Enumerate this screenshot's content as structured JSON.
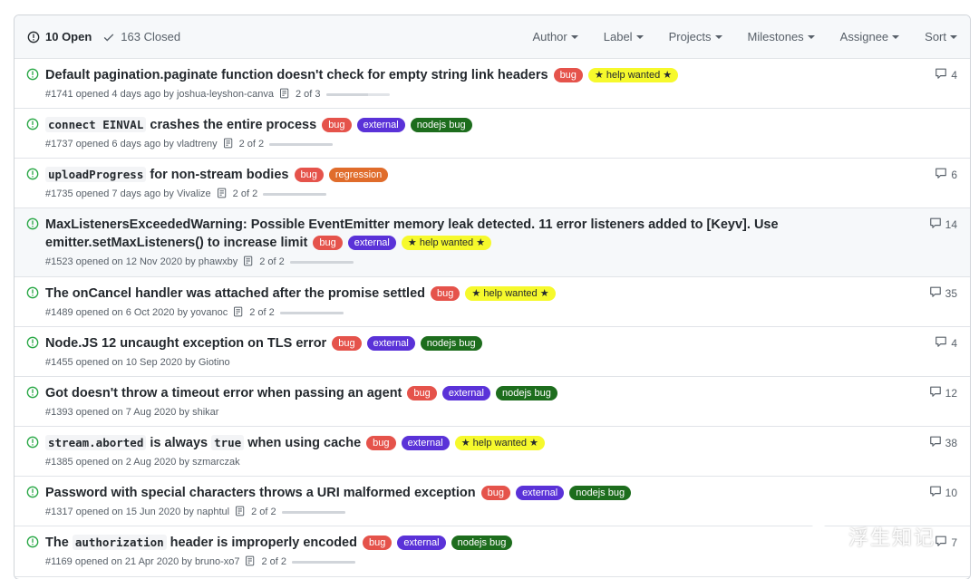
{
  "header": {
    "open_label": "10 Open",
    "closed_label": "163 Closed",
    "filters": [
      "Author",
      "Label",
      "Projects",
      "Milestones",
      "Assignee",
      "Sort"
    ]
  },
  "label_colors": {
    "bug": "#e5534b",
    "external": "#5a32d8",
    "nodejs bug": "#1d6d1d",
    "★ help wanted ★": "#f6f92c",
    "regression": "#e06c2b"
  },
  "issues": [
    {
      "title": "Default pagination.paginate function doesn't check for empty string link headers",
      "labels": [
        "bug",
        "★ help wanted ★"
      ],
      "meta": "#1741 opened 4 days ago by joshua-leyshon-canva",
      "tasks": "2 of 3",
      "progress": 0.67,
      "comments": "4"
    },
    {
      "title_code": "connect EINVAL",
      "title": " crashes the entire process",
      "labels": [
        "bug",
        "external",
        "nodejs bug"
      ],
      "meta": "#1737 opened 6 days ago by vladtreny",
      "tasks": "2 of 2",
      "progress": 1,
      "comments": ""
    },
    {
      "title_code": "uploadProgress",
      "title": " for non-stream bodies",
      "labels": [
        "bug",
        "regression"
      ],
      "meta": "#1735 opened 7 days ago by Vivalize",
      "tasks": "2 of 2",
      "progress": 1,
      "comments": "6"
    },
    {
      "title": "MaxListenersExceededWarning: Possible EventEmitter memory leak detected. 11 error listeners added to [Keyv]. Use emitter.setMaxListeners() to increase limit",
      "labels": [
        "bug",
        "external",
        "★ help wanted ★"
      ],
      "meta": "#1523 opened on 12 Nov 2020 by phawxby",
      "tasks": "2 of 2",
      "progress": 1,
      "comments": "14"
    },
    {
      "title": "The onCancel handler was attached after the promise settled",
      "labels": [
        "bug",
        "★ help wanted ★"
      ],
      "meta": "#1489 opened on 6 Oct 2020 by yovanoc",
      "tasks": "2 of 2",
      "progress": 1,
      "comments": "35"
    },
    {
      "title": "Node.JS 12 uncaught exception on TLS error",
      "labels": [
        "bug",
        "external",
        "nodejs bug"
      ],
      "meta": "#1455 opened on 10 Sep 2020 by Giotino",
      "tasks": "",
      "progress": null,
      "comments": "4"
    },
    {
      "title": "Got doesn't throw a timeout error when passing an agent",
      "labels": [
        "bug",
        "external",
        "nodejs bug"
      ],
      "meta": "#1393 opened on 7 Aug 2020 by shikar",
      "tasks": "",
      "progress": null,
      "comments": "12"
    },
    {
      "title_code": "stream.aborted",
      "title": " is always ",
      "title_code2": "true",
      "title_tail": " when using cache",
      "labels": [
        "bug",
        "external",
        "★ help wanted ★"
      ],
      "meta": "#1385 opened on 2 Aug 2020 by szmarczak",
      "tasks": "",
      "progress": null,
      "comments": "38"
    },
    {
      "title": "Password with special characters throws a URI malformed exception",
      "labels": [
        "bug",
        "external",
        "nodejs bug"
      ],
      "meta": "#1317 opened on 15 Jun 2020 by naphtul",
      "tasks": "2 of 2",
      "progress": 1,
      "comments": "10"
    },
    {
      "title_prefix": "The ",
      "title_code": "authorization",
      "title": " header is improperly encoded",
      "labels": [
        "bug",
        "external",
        "nodejs bug"
      ],
      "meta": "#1169 opened on 21 Apr 2020 by bruno-xo7",
      "tasks": "2 of 2",
      "progress": 1,
      "comments": "7"
    }
  ],
  "watermark": "浮生知记"
}
